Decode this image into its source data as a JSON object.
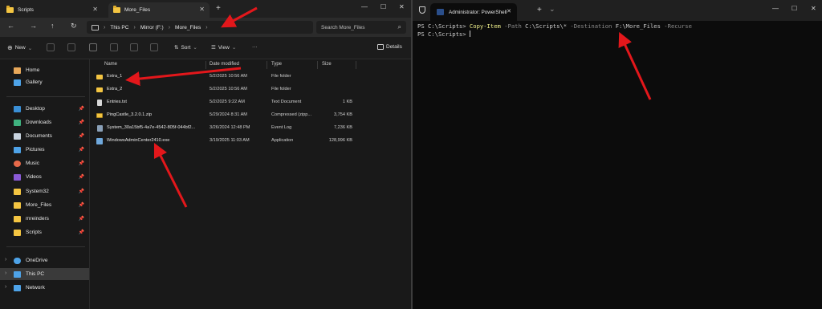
{
  "explorer": {
    "tabs": [
      {
        "label": "Scripts",
        "active": false
      },
      {
        "label": "More_Files",
        "active": true
      }
    ],
    "breadcrumbs": [
      "This PC",
      "Mirror (F:)",
      "More_Files"
    ],
    "search_placeholder": "Search More_Files",
    "command_bar": {
      "new_label": "New",
      "sort_label": "Sort",
      "view_label": "View",
      "more_label": "···",
      "details_label": "Details"
    },
    "sidebar": {
      "top": [
        {
          "label": "Home",
          "icon": "home-icon",
          "color": "#e8a85a"
        },
        {
          "label": "Gallery",
          "icon": "gallery-icon",
          "color": "#4ea3e8"
        }
      ],
      "pinned": [
        {
          "label": "Desktop",
          "icon": "desktop-icon",
          "color": "#3a8fd6"
        },
        {
          "label": "Downloads",
          "icon": "download-icon",
          "color": "#3fb27f"
        },
        {
          "label": "Documents",
          "icon": "documents-icon",
          "color": "#c9d4e0"
        },
        {
          "label": "Pictures",
          "icon": "pictures-icon",
          "color": "#4ea3e8"
        },
        {
          "label": "Music",
          "icon": "music-icon",
          "color": "#e86a4a"
        },
        {
          "label": "Videos",
          "icon": "videos-icon",
          "color": "#8a5ad6"
        },
        {
          "label": "System32",
          "icon": "folder-icon",
          "color": "#f4c542"
        },
        {
          "label": "More_Files",
          "icon": "folder-icon",
          "color": "#f4c542"
        },
        {
          "label": "mreinders",
          "icon": "folder-icon",
          "color": "#f4c542"
        },
        {
          "label": "Scripts",
          "icon": "folder-icon",
          "color": "#f4c542"
        }
      ],
      "bottom": [
        {
          "label": "OneDrive",
          "icon": "onedrive-icon",
          "color": "#4ea3e8"
        },
        {
          "label": "This PC",
          "icon": "pc-icon",
          "color": "#4ea3e8"
        },
        {
          "label": "Network",
          "icon": "network-icon",
          "color": "#4ea3e8"
        }
      ]
    },
    "columns": [
      "Name",
      "Date modified",
      "Type",
      "Size"
    ],
    "files": [
      {
        "name": "Extra_1",
        "date": "5/2/2025 10:56 AM",
        "type": "File folder",
        "size": "",
        "icon": "folder-icon",
        "color": "#f4c542"
      },
      {
        "name": "Extra_2",
        "date": "5/2/2025 10:56 AM",
        "type": "File folder",
        "size": "",
        "icon": "folder-icon",
        "color": "#f4c542"
      },
      {
        "name": "Entries.txt",
        "date": "5/2/2025 9:22 AM",
        "type": "Text Document",
        "size": "1 KB",
        "icon": "text-file-icon",
        "color": "#d8d8d8"
      },
      {
        "name": "PingCastle_3.2.0.1.zip",
        "date": "5/29/2024 8:31 AM",
        "type": "Compressed (zipp...",
        "size": "3,754 KB",
        "icon": "zip-icon",
        "color": "#f4c542"
      },
      {
        "name": "System_30a15bf5-4a7e-4542-805f-044bf2...",
        "date": "3/26/2024 12:48 PM",
        "type": "Event Log",
        "size": "7,236 KB",
        "icon": "event-log-icon",
        "color": "#8aa0b8"
      },
      {
        "name": "WindowsAdminCenter2410.exe",
        "date": "3/19/2025 11:03 AM",
        "type": "Application",
        "size": "128,996 KB",
        "icon": "exe-icon",
        "color": "#6fa8dc"
      }
    ]
  },
  "terminal": {
    "tab_title": "Administrator: PowerShell",
    "lines": [
      {
        "prompt": "PS C:\\Scripts> ",
        "cmd": "Copy-Item",
        "p1": " -Path ",
        "a1": "C:\\Scripts\\*",
        "p2": " -Destination ",
        "a2": "F:\\More_Files",
        "p3": " -Recurse"
      },
      {
        "prompt": "PS C:\\Scripts> "
      }
    ]
  },
  "colors": {
    "arrow": "#e3171b",
    "explorer_bg": "#191919",
    "terminal_bg": "#0c0c0c",
    "command_yellow": "#f1f18c"
  }
}
